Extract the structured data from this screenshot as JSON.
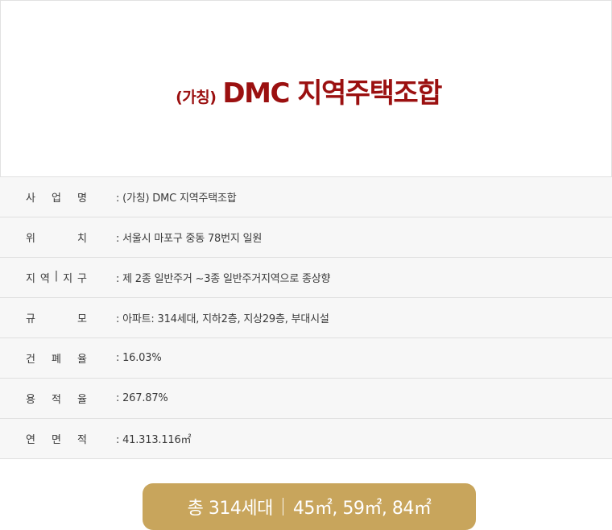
{
  "title": {
    "prefix": "(가칭)",
    "main": "DMC 지역주택조합"
  },
  "rows": [
    {
      "label_chars": [
        "사",
        "업",
        "명"
      ],
      "value": ": (가칭) DMC 지역주택조합"
    },
    {
      "label_chars": [
        "위",
        "치"
      ],
      "value": ": 서울시 마포구 중동 78번지 일원"
    },
    {
      "label_chars": [
        "지",
        "역",
        "|",
        "지",
        "구"
      ],
      "value": ": 제 2종 일반주거 ~3종 일반주거지역으로 종상향"
    },
    {
      "label_chars": [
        "규",
        "모"
      ],
      "value": ": 아파트: 314세대, 지하2층, 지상29층, 부대시설"
    },
    {
      "label_chars": [
        "건",
        "폐",
        "율"
      ],
      "value": ": 16.03%"
    },
    {
      "label_chars": [
        "용",
        "적",
        "율"
      ],
      "value": ": 267.87%"
    },
    {
      "label_chars": [
        "연",
        "면",
        "적"
      ],
      "value": ": 41.313.116㎡"
    }
  ],
  "badge": {
    "count": "총 314세대",
    "sizes": "45㎡, 59㎡, 84㎡"
  },
  "colors": {
    "title": "#9b1010",
    "badge_bg": "#c8a55c",
    "table_bg": "#f7f7f7"
  }
}
